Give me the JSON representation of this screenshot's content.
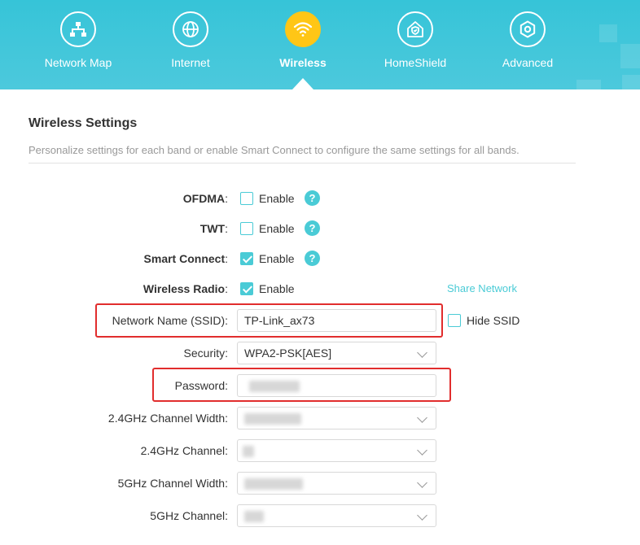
{
  "nav": {
    "items": [
      {
        "label": "Network Map",
        "icon": "network-map-icon"
      },
      {
        "label": "Internet",
        "icon": "globe-icon"
      },
      {
        "label": "Wireless",
        "icon": "wifi-icon",
        "active": true
      },
      {
        "label": "HomeShield",
        "icon": "homeshield-icon"
      },
      {
        "label": "Advanced",
        "icon": "gear-icon"
      }
    ]
  },
  "wireless_settings": {
    "title": "Wireless Settings",
    "description": "Personalize settings for each band or enable Smart Connect to configure the same settings for all bands."
  },
  "form": {
    "ofdma": {
      "label": "OFDMA",
      "colon": ":",
      "option": "Enable",
      "checked": false
    },
    "twt": {
      "label": "TWT",
      "colon": ":",
      "option": "Enable",
      "checked": false
    },
    "smart_connect": {
      "label": "Smart Connect",
      "colon": ":",
      "option": "Enable",
      "checked": true
    },
    "wireless_radio": {
      "label": "Wireless Radio",
      "colon": ":",
      "option": "Enable",
      "checked": true
    },
    "share_network": "Share Network",
    "ssid": {
      "label": "Network Name (SSID):",
      "value": "TP-Link_ax73"
    },
    "hide_ssid": {
      "label": "Hide SSID",
      "checked": false
    },
    "security": {
      "label": "Security:",
      "value": "WPA2-PSK[AES]"
    },
    "password": {
      "label": "Password:"
    },
    "channel_width_24": {
      "label": "2.4GHz Channel Width:"
    },
    "channel_24": {
      "label": "2.4GHz Channel:"
    },
    "channel_width_5": {
      "label": "5GHz Channel Width:"
    },
    "channel_5": {
      "label": "5GHz Channel:"
    }
  },
  "help_glyph": "?",
  "colors": {
    "accent": "#4acbd6",
    "active_nav": "#ffc616",
    "highlight": "#e12d2d",
    "header": "#3fc6da"
  }
}
